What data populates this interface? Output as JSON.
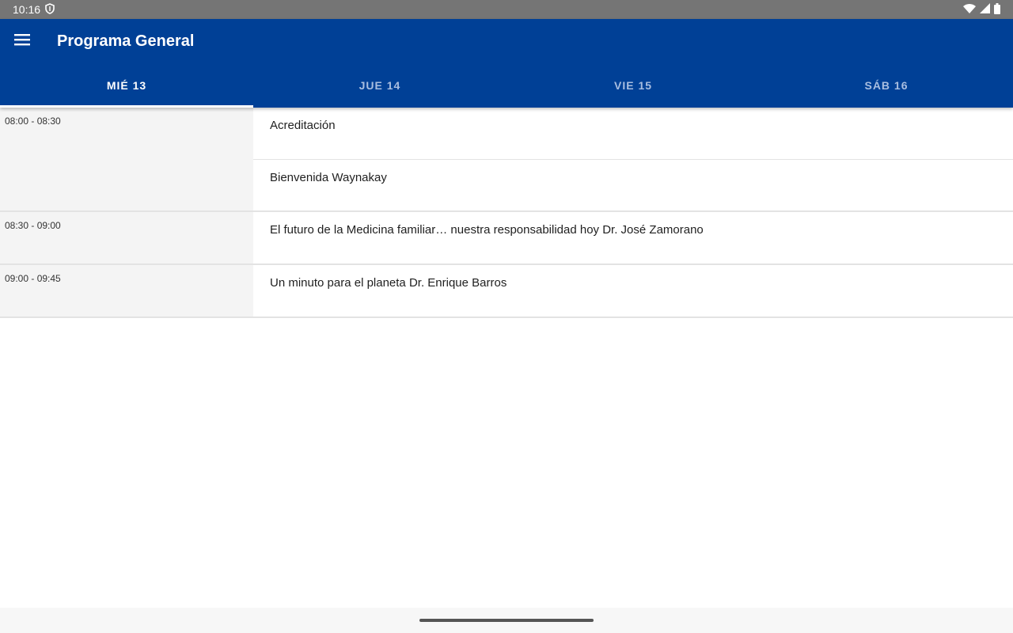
{
  "status_bar": {
    "time": "10:16",
    "icons": [
      "shield-icon",
      "wifi-icon",
      "signal-icon",
      "battery-icon"
    ]
  },
  "app_bar": {
    "title": "Programa General",
    "menu_icon": "menu-icon",
    "background_color": "#004096"
  },
  "tabs": [
    {
      "label": "MIÉ 13",
      "active": true
    },
    {
      "label": "JUE 14",
      "active": false
    },
    {
      "label": "VIE 15",
      "active": false
    },
    {
      "label": "SÁB 16",
      "active": false
    }
  ],
  "schedule": [
    {
      "time": "08:00 - 08:30",
      "events": [
        "Acreditación",
        "Bienvenida Waynakay"
      ]
    },
    {
      "time": "08:30 - 09:00",
      "events": [
        "El futuro de la Medicina familiar… nuestra responsabilidad hoy Dr. José Zamorano"
      ]
    },
    {
      "time": "09:00 - 09:45",
      "events": [
        "Un minuto para el planeta Dr. Enrique Barros"
      ]
    }
  ]
}
